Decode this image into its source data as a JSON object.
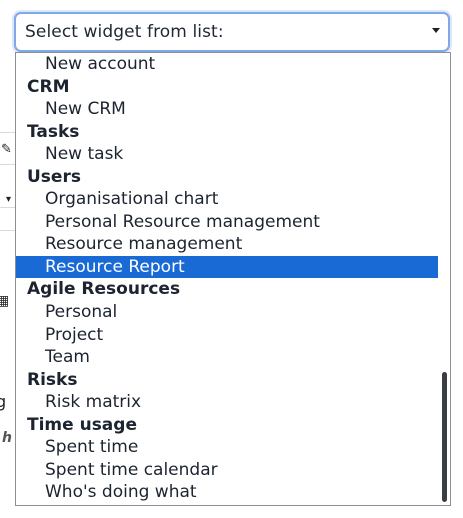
{
  "select": {
    "placeholder": "Select widget from list:"
  },
  "groups": [
    {
      "label": "",
      "items": [
        "New account"
      ]
    },
    {
      "label": "CRM",
      "items": [
        "New CRM"
      ]
    },
    {
      "label": "Tasks",
      "items": [
        "New task"
      ]
    },
    {
      "label": "Users",
      "items": [
        "Organisational chart",
        "Personal Resource management",
        "Resource management",
        "Resource Report"
      ]
    },
    {
      "label": "Agile Resources",
      "items": [
        "Personal",
        "Project",
        "Team"
      ]
    },
    {
      "label": "Risks",
      "items": [
        "Risk matrix"
      ]
    },
    {
      "label": "Time usage",
      "items": [
        "Spent time",
        "Spent time calendar",
        "Who's doing what"
      ]
    }
  ],
  "selected_item": "Resource Report",
  "background": {
    "fragments": [
      "g",
      "h"
    ]
  },
  "colors": {
    "selection": "#1a6ad6",
    "focus_border": "#7fa8e6"
  },
  "icons": [
    "chevron-down-icon",
    "pencil-icon",
    "calendar-icon"
  ]
}
